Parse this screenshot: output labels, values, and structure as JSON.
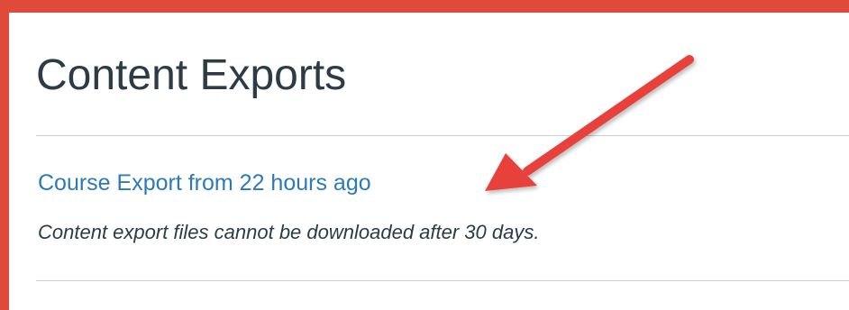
{
  "page": {
    "title": "Content Exports"
  },
  "exports": [
    {
      "link_label": "Course Export from 22 hours ago",
      "note": "Content export files cannot be downloaded after 30 days."
    }
  ],
  "colors": {
    "frame": "#e04a3a",
    "link": "#2b7abc",
    "text": "#2d3b45",
    "divider": "#c7cdd1",
    "arrow": "#e8403a"
  },
  "annotation": {
    "icon": "red-arrow-icon"
  }
}
